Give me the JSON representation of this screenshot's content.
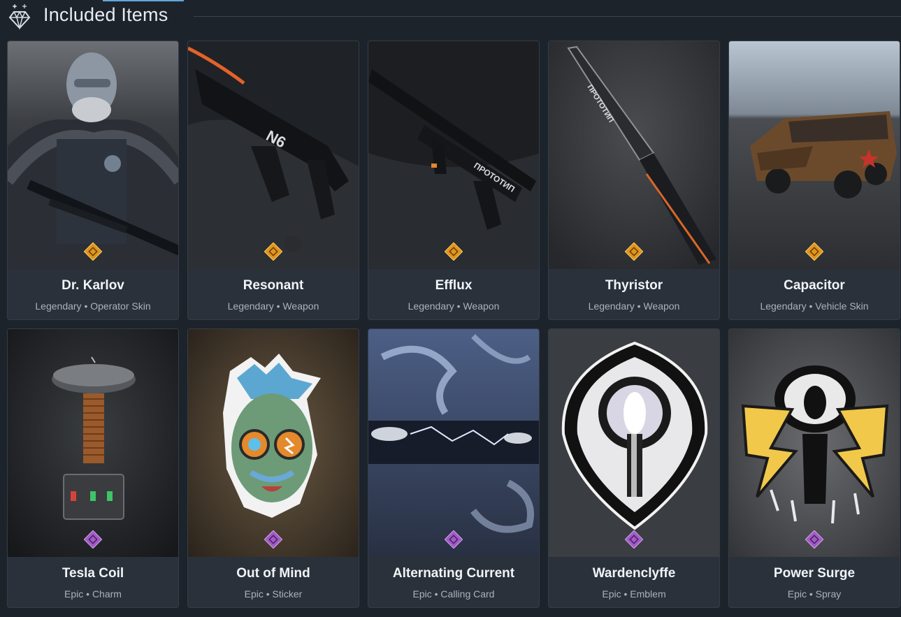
{
  "header": {
    "title": "Included Items",
    "icon": "diamond-icon"
  },
  "colors": {
    "background": "#1d232b",
    "card": "#2a313b",
    "legendary": "#e0951c",
    "epic": "#a05cc4"
  },
  "items": [
    {
      "name": "Dr. Karlov",
      "rarity": "Legendary",
      "type": "Operator Skin",
      "meta": "Legendary • Operator Skin"
    },
    {
      "name": "Resonant",
      "rarity": "Legendary",
      "type": "Weapon",
      "meta": "Legendary • Weapon"
    },
    {
      "name": "Efflux",
      "rarity": "Legendary",
      "type": "Weapon",
      "meta": "Legendary • Weapon"
    },
    {
      "name": "Thyristor",
      "rarity": "Legendary",
      "type": "Weapon",
      "meta": "Legendary • Weapon"
    },
    {
      "name": "Capacitor",
      "rarity": "Legendary",
      "type": "Vehicle Skin",
      "meta": "Legendary • Vehicle Skin"
    },
    {
      "name": "Tesla Coil",
      "rarity": "Epic",
      "type": "Charm",
      "meta": "Epic • Charm"
    },
    {
      "name": "Out of Mind",
      "rarity": "Epic",
      "type": "Sticker",
      "meta": "Epic • Sticker"
    },
    {
      "name": "Alternating Current",
      "rarity": "Epic",
      "type": "Calling Card",
      "meta": "Epic • Calling Card"
    },
    {
      "name": "Wardenclyffe",
      "rarity": "Epic",
      "type": "Emblem",
      "meta": "Epic • Emblem"
    },
    {
      "name": "Power Surge",
      "rarity": "Epic",
      "type": "Spray",
      "meta": "Epic • Spray"
    }
  ]
}
